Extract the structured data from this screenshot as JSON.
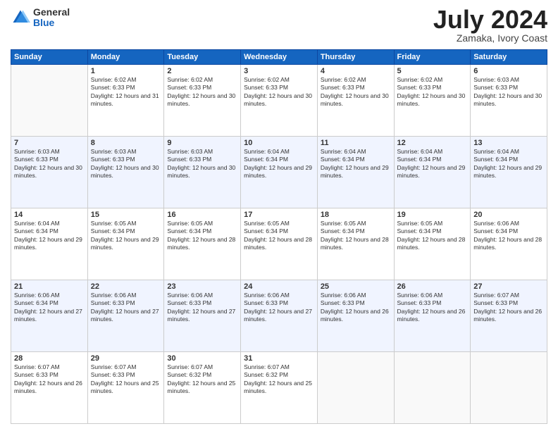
{
  "logo": {
    "general": "General",
    "blue": "Blue"
  },
  "title": "July 2024",
  "location": "Zamaka, Ivory Coast",
  "days_of_week": [
    "Sunday",
    "Monday",
    "Tuesday",
    "Wednesday",
    "Thursday",
    "Friday",
    "Saturday"
  ],
  "weeks": [
    [
      {
        "day": "",
        "empty": true
      },
      {
        "day": "1",
        "sunrise": "6:02 AM",
        "sunset": "6:33 PM",
        "daylight": "12 hours and 31 minutes."
      },
      {
        "day": "2",
        "sunrise": "6:02 AM",
        "sunset": "6:33 PM",
        "daylight": "12 hours and 30 minutes."
      },
      {
        "day": "3",
        "sunrise": "6:02 AM",
        "sunset": "6:33 PM",
        "daylight": "12 hours and 30 minutes."
      },
      {
        "day": "4",
        "sunrise": "6:02 AM",
        "sunset": "6:33 PM",
        "daylight": "12 hours and 30 minutes."
      },
      {
        "day": "5",
        "sunrise": "6:02 AM",
        "sunset": "6:33 PM",
        "daylight": "12 hours and 30 minutes."
      },
      {
        "day": "6",
        "sunrise": "6:03 AM",
        "sunset": "6:33 PM",
        "daylight": "12 hours and 30 minutes."
      }
    ],
    [
      {
        "day": "7",
        "sunrise": "6:03 AM",
        "sunset": "6:33 PM",
        "daylight": "12 hours and 30 minutes."
      },
      {
        "day": "8",
        "sunrise": "6:03 AM",
        "sunset": "6:33 PM",
        "daylight": "12 hours and 30 minutes."
      },
      {
        "day": "9",
        "sunrise": "6:03 AM",
        "sunset": "6:33 PM",
        "daylight": "12 hours and 30 minutes."
      },
      {
        "day": "10",
        "sunrise": "6:04 AM",
        "sunset": "6:34 PM",
        "daylight": "12 hours and 29 minutes."
      },
      {
        "day": "11",
        "sunrise": "6:04 AM",
        "sunset": "6:34 PM",
        "daylight": "12 hours and 29 minutes."
      },
      {
        "day": "12",
        "sunrise": "6:04 AM",
        "sunset": "6:34 PM",
        "daylight": "12 hours and 29 minutes."
      },
      {
        "day": "13",
        "sunrise": "6:04 AM",
        "sunset": "6:34 PM",
        "daylight": "12 hours and 29 minutes."
      }
    ],
    [
      {
        "day": "14",
        "sunrise": "6:04 AM",
        "sunset": "6:34 PM",
        "daylight": "12 hours and 29 minutes."
      },
      {
        "day": "15",
        "sunrise": "6:05 AM",
        "sunset": "6:34 PM",
        "daylight": "12 hours and 29 minutes."
      },
      {
        "day": "16",
        "sunrise": "6:05 AM",
        "sunset": "6:34 PM",
        "daylight": "12 hours and 28 minutes."
      },
      {
        "day": "17",
        "sunrise": "6:05 AM",
        "sunset": "6:34 PM",
        "daylight": "12 hours and 28 minutes."
      },
      {
        "day": "18",
        "sunrise": "6:05 AM",
        "sunset": "6:34 PM",
        "daylight": "12 hours and 28 minutes."
      },
      {
        "day": "19",
        "sunrise": "6:05 AM",
        "sunset": "6:34 PM",
        "daylight": "12 hours and 28 minutes."
      },
      {
        "day": "20",
        "sunrise": "6:06 AM",
        "sunset": "6:34 PM",
        "daylight": "12 hours and 28 minutes."
      }
    ],
    [
      {
        "day": "21",
        "sunrise": "6:06 AM",
        "sunset": "6:34 PM",
        "daylight": "12 hours and 27 minutes."
      },
      {
        "day": "22",
        "sunrise": "6:06 AM",
        "sunset": "6:33 PM",
        "daylight": "12 hours and 27 minutes."
      },
      {
        "day": "23",
        "sunrise": "6:06 AM",
        "sunset": "6:33 PM",
        "daylight": "12 hours and 27 minutes."
      },
      {
        "day": "24",
        "sunrise": "6:06 AM",
        "sunset": "6:33 PM",
        "daylight": "12 hours and 27 minutes."
      },
      {
        "day": "25",
        "sunrise": "6:06 AM",
        "sunset": "6:33 PM",
        "daylight": "12 hours and 26 minutes."
      },
      {
        "day": "26",
        "sunrise": "6:06 AM",
        "sunset": "6:33 PM",
        "daylight": "12 hours and 26 minutes."
      },
      {
        "day": "27",
        "sunrise": "6:07 AM",
        "sunset": "6:33 PM",
        "daylight": "12 hours and 26 minutes."
      }
    ],
    [
      {
        "day": "28",
        "sunrise": "6:07 AM",
        "sunset": "6:33 PM",
        "daylight": "12 hours and 26 minutes."
      },
      {
        "day": "29",
        "sunrise": "6:07 AM",
        "sunset": "6:33 PM",
        "daylight": "12 hours and 25 minutes."
      },
      {
        "day": "30",
        "sunrise": "6:07 AM",
        "sunset": "6:32 PM",
        "daylight": "12 hours and 25 minutes."
      },
      {
        "day": "31",
        "sunrise": "6:07 AM",
        "sunset": "6:32 PM",
        "daylight": "12 hours and 25 minutes."
      },
      {
        "day": "",
        "empty": true
      },
      {
        "day": "",
        "empty": true
      },
      {
        "day": "",
        "empty": true
      }
    ]
  ]
}
